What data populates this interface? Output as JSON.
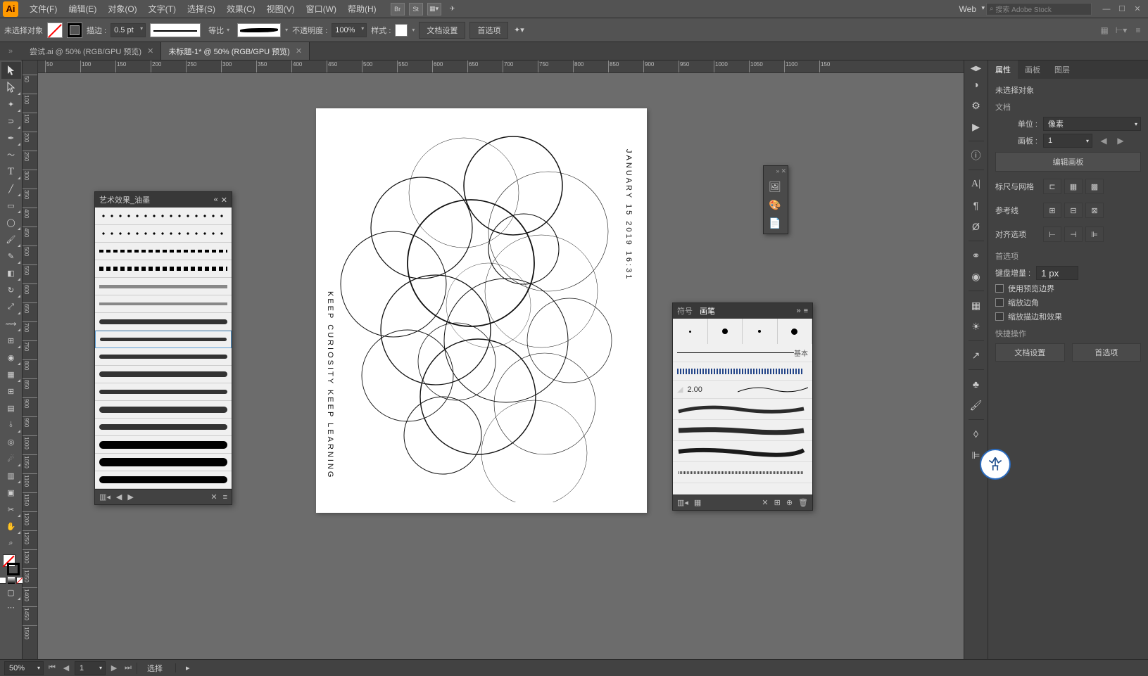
{
  "menus": [
    "文件(F)",
    "编辑(E)",
    "对象(O)",
    "文字(T)",
    "选择(S)",
    "效果(C)",
    "视图(V)",
    "窗口(W)",
    "帮助(H)"
  ],
  "menu_badges": [
    "Br",
    "St"
  ],
  "workspace": "Web",
  "stock_placeholder": "搜索 Adobe Stock",
  "control": {
    "selection_label": "未选择对象",
    "stroke_label": "描边 :",
    "stroke_weight": "0.5 pt",
    "ratio_label": "等比",
    "opacity_label": "不透明度 :",
    "opacity_value": "100%",
    "style_label": "样式 :",
    "doc_setup": "文档设置",
    "prefs": "首选项"
  },
  "tabs": [
    {
      "label": "尝试.ai @ 50% (RGB/GPU 预览)",
      "active": false
    },
    {
      "label": "未标题-1* @ 50% (RGB/GPU 预览)",
      "active": true
    }
  ],
  "hruler_labels": [
    "50",
    "100",
    "150",
    "200",
    "250",
    "300",
    "350",
    "400",
    "450",
    "500",
    "550",
    "600",
    "650",
    "700",
    "750",
    "800",
    "850",
    "900",
    "950",
    "1000",
    "1050",
    "1100",
    "150"
  ],
  "vruler_labels": [
    "50",
    "100",
    "150",
    "200",
    "250",
    "300",
    "350",
    "400",
    "450",
    "500",
    "550",
    "600",
    "650",
    "700",
    "750",
    "800",
    "850",
    "900",
    "950",
    "1000",
    "1050",
    "1100",
    "1150",
    "1200",
    "1250",
    "1300",
    "1350",
    "1400",
    "1450",
    "1500"
  ],
  "artboard": {
    "left_text": "KEEP CURIOSITY KEEP LEARNING",
    "right_text": "JANUARY 15 2019 16:31"
  },
  "brush_lib": {
    "title": "艺术效果_油墨"
  },
  "brush_panel": {
    "tab1": "符号",
    "tab2": "画笔",
    "basic": "基本",
    "brush_value": "2.00"
  },
  "props": {
    "tabs": [
      "属性",
      "画板",
      "图层"
    ],
    "no_selection": "未选择对象",
    "document": "文档",
    "unit_label": "单位 :",
    "unit_value": "像素",
    "artboard_label": "画板 :",
    "artboard_value": "1",
    "edit_artboard": "编辑画板",
    "rulers_grids": "标尺与网格",
    "guides": "参考线",
    "align_options": "对齐选项",
    "prefs": "首选项",
    "key_increment_label": "键盘增量 :",
    "key_increment_value": "1 px",
    "preview_bounds": "使用预览边界",
    "scale_corners": "缩放边角",
    "scale_strokes": "缩放描边和效果",
    "quick_actions": "快捷操作",
    "doc_setup": "文档设置",
    "prefs_btn": "首选项"
  },
  "status": {
    "zoom": "50%",
    "page": "1",
    "mode": "选择"
  },
  "tools": [
    "selection",
    "direct-selection",
    "magic-wand",
    "lasso",
    "pen",
    "curvature",
    "type",
    "line",
    "rectangle",
    "ellipse",
    "paintbrush",
    "pencil",
    "eraser",
    "rotate",
    "scale",
    "width",
    "free-transform",
    "shape-builder",
    "perspective-grid",
    "mesh",
    "gradient",
    "eyedropper",
    "blend",
    "symbol-sprayer",
    "column-graph",
    "artboard",
    "slice",
    "hand",
    "zoom"
  ]
}
